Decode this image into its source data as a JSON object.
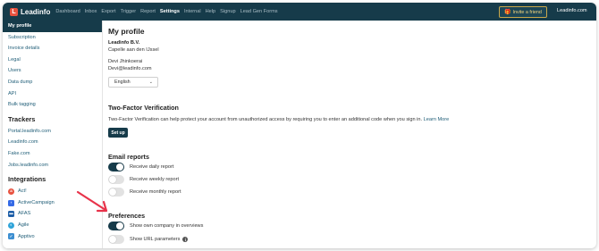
{
  "colors": {
    "nav_bg": "#163b4a",
    "accent_link": "#1f5d77",
    "logo_red": "#e8523f",
    "invite_border": "#c9a84a",
    "annotation_arrow": "#e8334a"
  },
  "nav": {
    "logo_text": "Leadinfo",
    "items": [
      "Dashboard",
      "Inbox",
      "Export",
      "Trigger",
      "Report",
      "Settings",
      "Internal",
      "Help",
      "Signup",
      "Lead Gen Forms"
    ],
    "active": "Settings",
    "invite_label": "Invite a friend",
    "domain": "Leadinfo.com"
  },
  "sidebar": {
    "settings_items": [
      "My profile",
      "Subscription",
      "Invoice details",
      "Legal",
      "Users",
      "Data dump",
      "API",
      "Bulk tagging"
    ],
    "trackers_heading": "Trackers",
    "trackers": [
      "Portal.leadinfo.com",
      "Leadinfo.com",
      "Fake.com",
      "Jobs.leadinfo.com"
    ],
    "integrations_heading": "Integrations",
    "integrations": [
      {
        "label": "Act!",
        "icon": "act-logo-icon",
        "color": "#e8523f"
      },
      {
        "label": "ActiveCampaign",
        "icon": "activecampaign-logo-icon",
        "color": "#356ae6"
      },
      {
        "label": "AFAS",
        "icon": "afas-logo-icon",
        "color": "#1f5fa8"
      },
      {
        "label": "Agile",
        "icon": "agile-logo-icon",
        "color": "#2fa4d9"
      },
      {
        "label": "Apptivo",
        "icon": "apptivo-logo-icon",
        "color": "#3d8fd1"
      }
    ]
  },
  "profile": {
    "title": "My profile",
    "company": "Leadinfo B.V.",
    "city": "Capelle aan den IJssel",
    "name": "Devi Jhinkoerai",
    "email": "Devi@leadinfo.com",
    "language": "English"
  },
  "two_factor": {
    "title": "Two-Factor Verification",
    "description": "Two-Factor Verification can help protect your account from unauthorized access by requiring you to enter an additional code when you sign in.",
    "learn_more": "Learn More",
    "button": "Set up"
  },
  "email_reports": {
    "title": "Email reports",
    "toggles": [
      {
        "label": "Receive daily report",
        "on": true
      },
      {
        "label": "Receive weekly report",
        "on": false
      },
      {
        "label": "Receive monthly report",
        "on": false
      }
    ]
  },
  "preferences": {
    "title": "Preferences",
    "toggles": [
      {
        "label": "Show own company in overviews",
        "on": true
      },
      {
        "label": "Show URL parameters",
        "on": false
      }
    ]
  }
}
